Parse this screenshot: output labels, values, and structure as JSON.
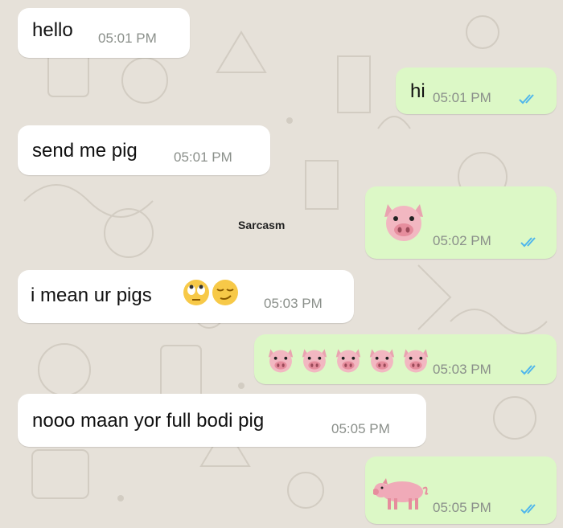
{
  "watermark": "Sarcasm",
  "colors": {
    "background": "#e6e1d9",
    "incoming_bubble": "#ffffff",
    "outgoing_bubble": "#dcf8c6",
    "read_ticks": "#4fb6ec",
    "timestamp": "#8a8f8a"
  },
  "messages": [
    {
      "direction": "incoming",
      "text": "hello",
      "time": "05:01 PM"
    },
    {
      "direction": "outgoing",
      "text": "hi",
      "time": "05:01 PM",
      "status": "read"
    },
    {
      "direction": "incoming",
      "text": "send me pig",
      "time": "05:01 PM"
    },
    {
      "direction": "outgoing",
      "content": "pig-face-emoji",
      "time": "05:02 PM",
      "status": "read"
    },
    {
      "direction": "incoming",
      "text": "i mean ur pigs",
      "emojis": [
        "face-with-rolling-eyes-emoji",
        "smirking-face-emoji"
      ],
      "time": "05:03 PM"
    },
    {
      "direction": "outgoing",
      "content": "pig-face-emoji x5",
      "time": "05:03 PM",
      "status": "read"
    },
    {
      "direction": "incoming",
      "text": "nooo maan yor full bodi pig",
      "time": "05:05 PM"
    },
    {
      "direction": "outgoing",
      "content": "pig-emoji",
      "time": "05:05 PM",
      "status": "read"
    }
  ]
}
